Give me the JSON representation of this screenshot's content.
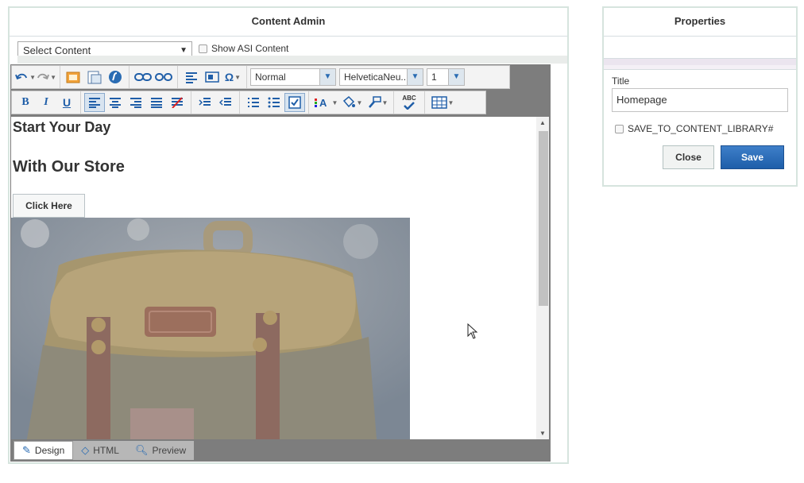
{
  "admin": {
    "title": "Content Admin",
    "select_content": "Select Content",
    "show_asi_label": "Show ASI Content"
  },
  "toolbar": {
    "format_select": "Normal",
    "font_select": "HelveticaNeu...",
    "size_select": "1",
    "bold_label": "B",
    "italic_label": "I",
    "underline_label": "U",
    "omega_label": "Ω",
    "spell_label": "ABC"
  },
  "editor": {
    "heading1": "Start Your Day",
    "heading2": "With Our Store",
    "button_label": "Click Here"
  },
  "modes": {
    "design": "Design",
    "html": "HTML",
    "preview": "Preview"
  },
  "properties": {
    "title": "Properties",
    "field_label": "Title",
    "field_value": "Homepage",
    "save_to_library": "SAVE_TO_CONTENT_LIBRARY#",
    "close_label": "Close",
    "save_label": "Save"
  },
  "colors": {
    "accent": "#2a6cb3",
    "panel_border": "#d6e4de",
    "save_button": "#2463ad"
  }
}
